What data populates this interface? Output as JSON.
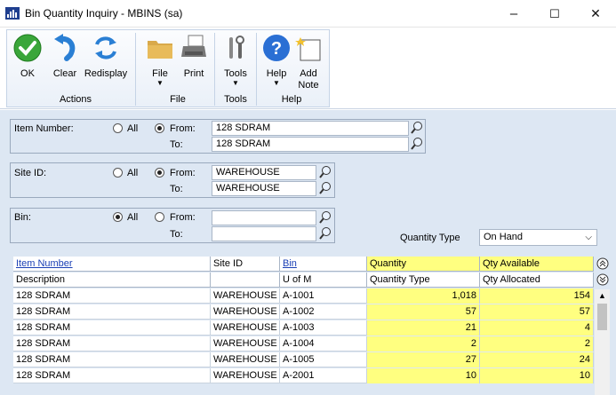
{
  "window": {
    "title": "Bin Quantity Inquiry  -  MBINS (sa)",
    "minimize": "–",
    "maximize": "☐",
    "close": "✕"
  },
  "ribbon": {
    "ok": "OK",
    "clear": "Clear",
    "redisplay": "Redisplay",
    "file": "File",
    "print": "Print",
    "tools": "Tools",
    "help": "Help",
    "add_note_1": "Add",
    "add_note_2": "Note",
    "groups": {
      "actions": "Actions",
      "file": "File",
      "tools": "Tools",
      "help": "Help"
    }
  },
  "filters": {
    "item": {
      "label": "Item Number:",
      "all": "All",
      "from": "From:",
      "to": "To:",
      "from_value": "128 SDRAM",
      "to_value": "128 SDRAM",
      "selected": "from"
    },
    "site": {
      "label": "Site ID:",
      "all": "All",
      "from": "From:",
      "to": "To:",
      "from_value": "WAREHOUSE",
      "to_value": "WAREHOUSE",
      "selected": "from"
    },
    "bin": {
      "label": "Bin:",
      "all": "All",
      "from": "From:",
      "to": "To:",
      "from_value": "",
      "to_value": "",
      "selected": "all"
    },
    "quantity_type": {
      "label": "Quantity Type",
      "value": "On Hand"
    }
  },
  "grid": {
    "headers": {
      "item_number": "Item Number",
      "site_id": "Site ID",
      "bin": "Bin",
      "quantity": "Quantity",
      "qty_available": "Qty Available",
      "description": "Description",
      "u_of_m": "U of M",
      "quantity_type": "Quantity Type",
      "qty_allocated": "Qty Allocated"
    },
    "rows": [
      {
        "item": "128 SDRAM",
        "site": "WAREHOUSE",
        "bin": "A-1001",
        "quantity": "1,018",
        "available": "154"
      },
      {
        "item": "128 SDRAM",
        "site": "WAREHOUSE",
        "bin": "A-1002",
        "quantity": "57",
        "available": "57"
      },
      {
        "item": "128 SDRAM",
        "site": "WAREHOUSE",
        "bin": "A-1003",
        "quantity": "21",
        "available": "4"
      },
      {
        "item": "128 SDRAM",
        "site": "WAREHOUSE",
        "bin": "A-1004",
        "quantity": "2",
        "available": "2"
      },
      {
        "item": "128 SDRAM",
        "site": "WAREHOUSE",
        "bin": "A-1005",
        "quantity": "27",
        "available": "24"
      },
      {
        "item": "128 SDRAM",
        "site": "WAREHOUSE",
        "bin": "A-2001",
        "quantity": "10",
        "available": "10"
      }
    ]
  },
  "colors": {
    "highlight": "#ffff80",
    "form_bg": "#dde7f3",
    "link": "#1a3fb5"
  }
}
